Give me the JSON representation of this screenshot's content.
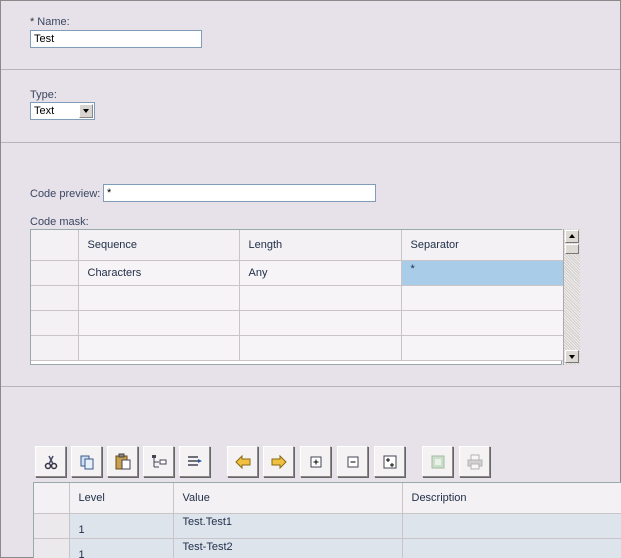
{
  "name_field": {
    "label": "Name:",
    "required_mark": "*",
    "value": "Test"
  },
  "type_field": {
    "label": "Type:",
    "value": "Text"
  },
  "code_preview": {
    "label": "Code preview:",
    "value": "*"
  },
  "code_mask": {
    "label": "Code mask:",
    "columns": [
      "Sequence",
      "Length",
      "Separator"
    ],
    "rows": [
      [
        "Characters",
        "Any",
        "*"
      ],
      [
        "",
        "",
        ""
      ],
      [
        "",
        "",
        ""
      ],
      [
        "",
        "",
        ""
      ]
    ]
  },
  "toolbar": {
    "buttons": [
      {
        "icon": "cut-icon"
      },
      {
        "icon": "copy-icon"
      },
      {
        "icon": "paste-icon"
      },
      {
        "icon": "indent-icon"
      },
      {
        "icon": "outdent-icon"
      },
      {
        "icon": "arrow-left-icon"
      },
      {
        "icon": "arrow-right-icon"
      },
      {
        "icon": "expand-icon"
      },
      {
        "icon": "collapse-icon"
      },
      {
        "icon": "expand-all-icon"
      },
      {
        "icon": "export-icon"
      },
      {
        "icon": "print-icon"
      }
    ]
  },
  "values_grid": {
    "columns": [
      "Level",
      "Value",
      "Description"
    ],
    "rows": [
      [
        "1",
        "Test.Test1",
        ""
      ],
      [
        "1",
        "Test-Test2",
        ""
      ]
    ]
  },
  "colors": {
    "selection": "#a9cde8",
    "background": "#e7e2ea",
    "row_highlight": "#dde4ec"
  }
}
